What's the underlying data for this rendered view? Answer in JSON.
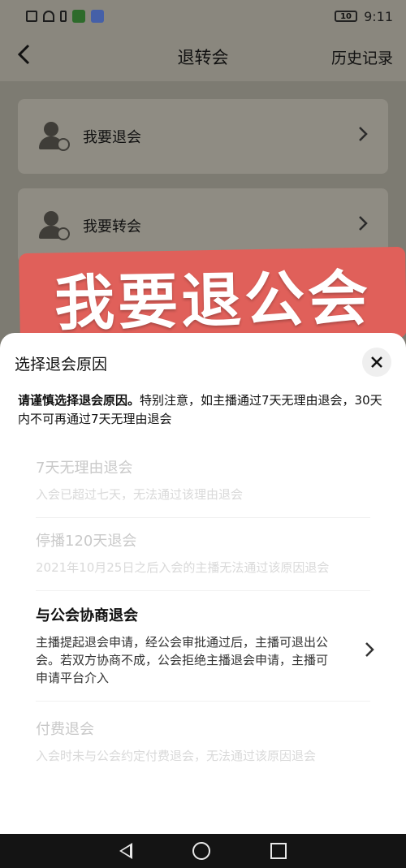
{
  "status_bar": {
    "time": "9:11",
    "battery": "10"
  },
  "nav": {
    "back_icon": "chevron-left-icon",
    "title": "退转会",
    "history": "历史记录"
  },
  "cards": [
    {
      "label": "我要退会",
      "icon": "user-minus-icon"
    },
    {
      "label": "我要转会",
      "icon": "user-transfer-icon"
    }
  ],
  "overlay": {
    "text": "我要退公会",
    "color": "#e0605a"
  },
  "sheet": {
    "title": "选择退会原因",
    "notice_bold": "请谨慎选择退会原因。",
    "notice_rest": "特别注意，如主播通过7天无理由退会，30天内不可再通过7天无理由退会",
    "reasons": [
      {
        "title": "7天无理由退会",
        "desc": "入会已超过七天，无法通过该理由退会",
        "enabled": false
      },
      {
        "title": "停播120天退会",
        "desc": "2021年10月25日之后入会的主播无法通过该原因退会",
        "enabled": false
      },
      {
        "title": "与公会协商退会",
        "desc": "主播提起退会申请，经公会审批通过后，主播可退出公会。若双方协商不成，公会拒绝主播退会申请，主播可申请平台介入",
        "enabled": true
      },
      {
        "title": "付费退会",
        "desc": "入会时未与公会约定付费退会，无法通过该原因退会",
        "enabled": false
      }
    ]
  }
}
